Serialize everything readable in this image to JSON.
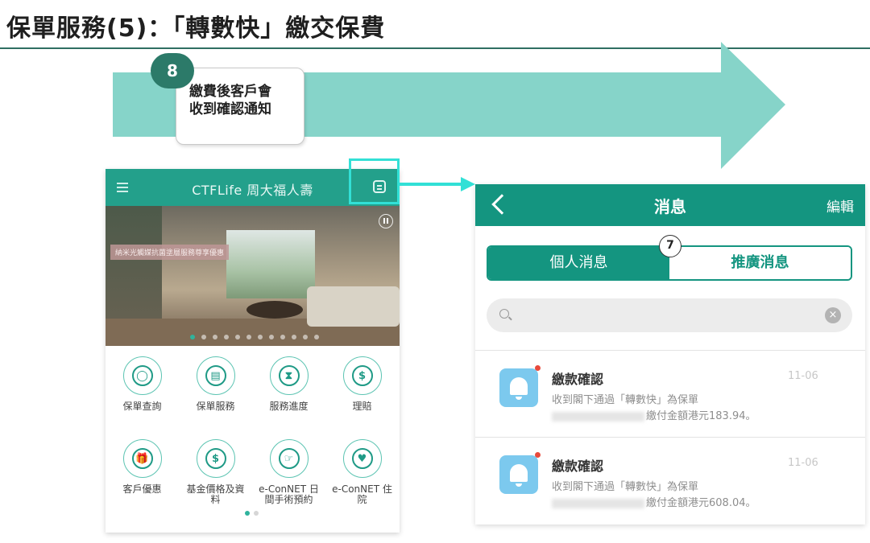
{
  "page": {
    "title": "保單服務(5)：「轉數快」繳交保費"
  },
  "step8": {
    "number": "8",
    "note_line1": "繳費後客戶會",
    "note_line2": "收到確認通知"
  },
  "left_app": {
    "brand": "CTFLife 周大福人壽",
    "banner_caption": "納米光觸媒抗菌塗層服務尊享優惠",
    "banner_slide_count": 12,
    "banner_active_slide": 1,
    "menu_items": [
      {
        "label": "保單查詢",
        "icon": "search-icon",
        "glyph": "◯"
      },
      {
        "label": "保單服務",
        "icon": "document-icon",
        "glyph": "▤"
      },
      {
        "label": "服務進度",
        "icon": "hourglass-icon",
        "glyph": "⧗"
      },
      {
        "label": "理賠",
        "icon": "shield-dollar-icon",
        "glyph": "$"
      },
      {
        "label": "客戶優惠",
        "icon": "gift-icon",
        "glyph": "🎁"
      },
      {
        "label": "基金價格及資料",
        "icon": "dollar-coin-icon",
        "glyph": "$"
      },
      {
        "label": "e-ConNET 日間手術預約",
        "icon": "calendar-icon",
        "glyph": "☞"
      },
      {
        "label": "e-ConNET 住院",
        "icon": "location-pin-icon",
        "glyph": "♥"
      }
    ],
    "page_count": 2,
    "active_page": 1
  },
  "right_app": {
    "back_label": "<",
    "title": "消息",
    "edit_label": "編輯",
    "step_number": "7",
    "tabs": [
      {
        "label": "個人消息",
        "active": true
      },
      {
        "label": "推廣消息",
        "active": false
      }
    ],
    "search_placeholder": "",
    "messages": [
      {
        "title": "繳款確認",
        "date": "11-06",
        "line1": "收到閣下通過「轉數快」為保單",
        "line2": "繳付金額港元183.94。"
      },
      {
        "title": "繳款確認",
        "date": "11-06",
        "line1": "收到閣下通過「轉數快」為保單",
        "line2": "繳付金額港元608.04。"
      }
    ]
  },
  "colors": {
    "brand_teal": "#23a08b",
    "header_teal": "#149580",
    "arrow_fill": "#86d4c9",
    "highlight": "#32e0d6",
    "unread_dot": "#e84a3c"
  }
}
